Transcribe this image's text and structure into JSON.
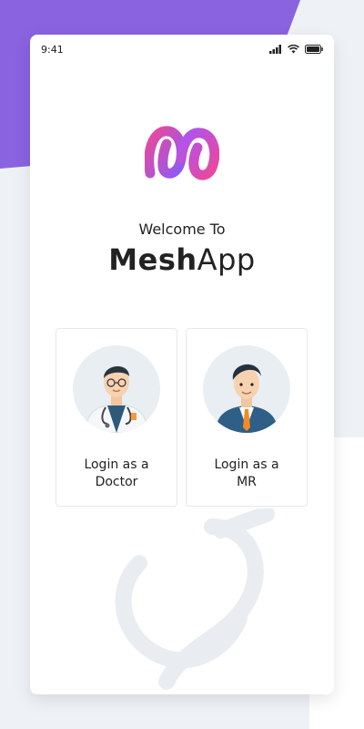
{
  "status_bar": {
    "time": "9:41",
    "icons": [
      "signal-icon",
      "wifi-icon",
      "battery-icon"
    ]
  },
  "header": {
    "welcome": "Welcome To",
    "brand_bold": "Mesh",
    "brand_regular": "App"
  },
  "cards": [
    {
      "line1": "Login as a",
      "line2": "Doctor",
      "icon": "doctor-avatar"
    },
    {
      "line1": "Login as a",
      "line2": "MR",
      "icon": "mr-avatar"
    }
  ],
  "colors": {
    "brand_purple": "#8b5cf6",
    "brand_pink": "#ec4899",
    "background_purple": "#8a63e0",
    "card_border": "#e6e8ec",
    "text_dark": "#222222"
  }
}
